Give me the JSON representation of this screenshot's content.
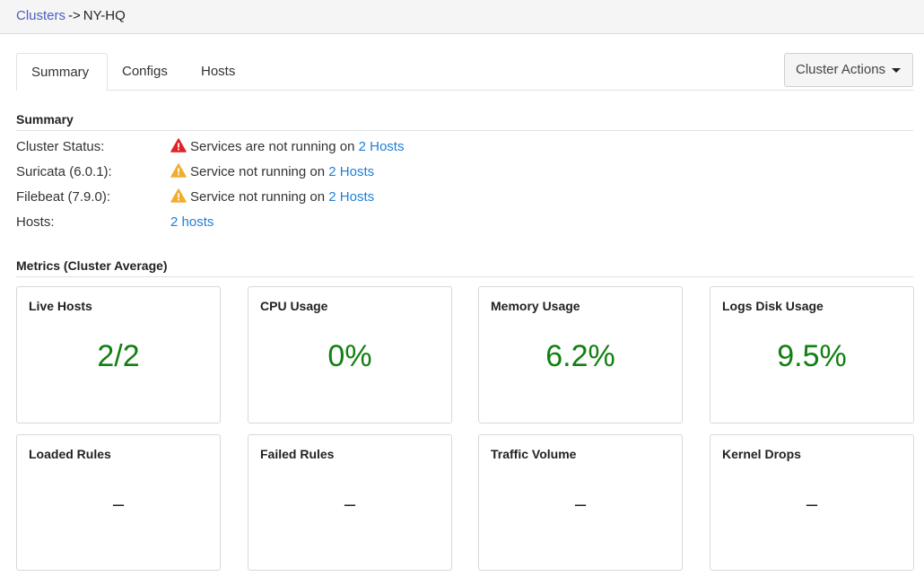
{
  "breadcrumb": {
    "parent": "Clusters",
    "separator": "->",
    "current": "NY-HQ"
  },
  "tabs": [
    {
      "label": "Summary",
      "active": true
    },
    {
      "label": "Configs",
      "active": false
    },
    {
      "label": "Hosts",
      "active": false
    }
  ],
  "actions": {
    "label": "Cluster Actions",
    "icon": "caret-down-icon"
  },
  "summary": {
    "title": "Summary",
    "rows": [
      {
        "label": "Cluster Status:",
        "icon": "error-triangle-icon",
        "text": "Services are not running on ",
        "link": "2 Hosts"
      },
      {
        "label": "Suricata (6.0.1):",
        "icon": "warning-triangle-icon",
        "text": "Service not running on ",
        "link": "2 Hosts"
      },
      {
        "label": "Filebeat (7.9.0):",
        "icon": "warning-triangle-icon",
        "text": "Service not running on ",
        "link": "2 Hosts"
      },
      {
        "label": "Hosts:",
        "link": "2 hosts"
      }
    ]
  },
  "metrics": {
    "title": "Metrics (Cluster Average)",
    "cards": [
      {
        "title": "Live Hosts",
        "value": "2/2"
      },
      {
        "title": "CPU Usage",
        "value": "0%"
      },
      {
        "title": "Memory Usage",
        "value": "6.2%"
      },
      {
        "title": "Logs Disk Usage",
        "value": "9.5%"
      },
      {
        "title": "Loaded Rules",
        "value": "–"
      },
      {
        "title": "Failed Rules",
        "value": "–"
      },
      {
        "title": "Traffic Volume",
        "value": "–"
      },
      {
        "title": "Kernel Drops",
        "value": "–"
      }
    ]
  },
  "colors": {
    "link": "#1f7fd6",
    "breadcrumb_link": "#4a5ec2",
    "metric_value": "#118011",
    "error": "#e02424",
    "warning": "#f0ad2e"
  }
}
